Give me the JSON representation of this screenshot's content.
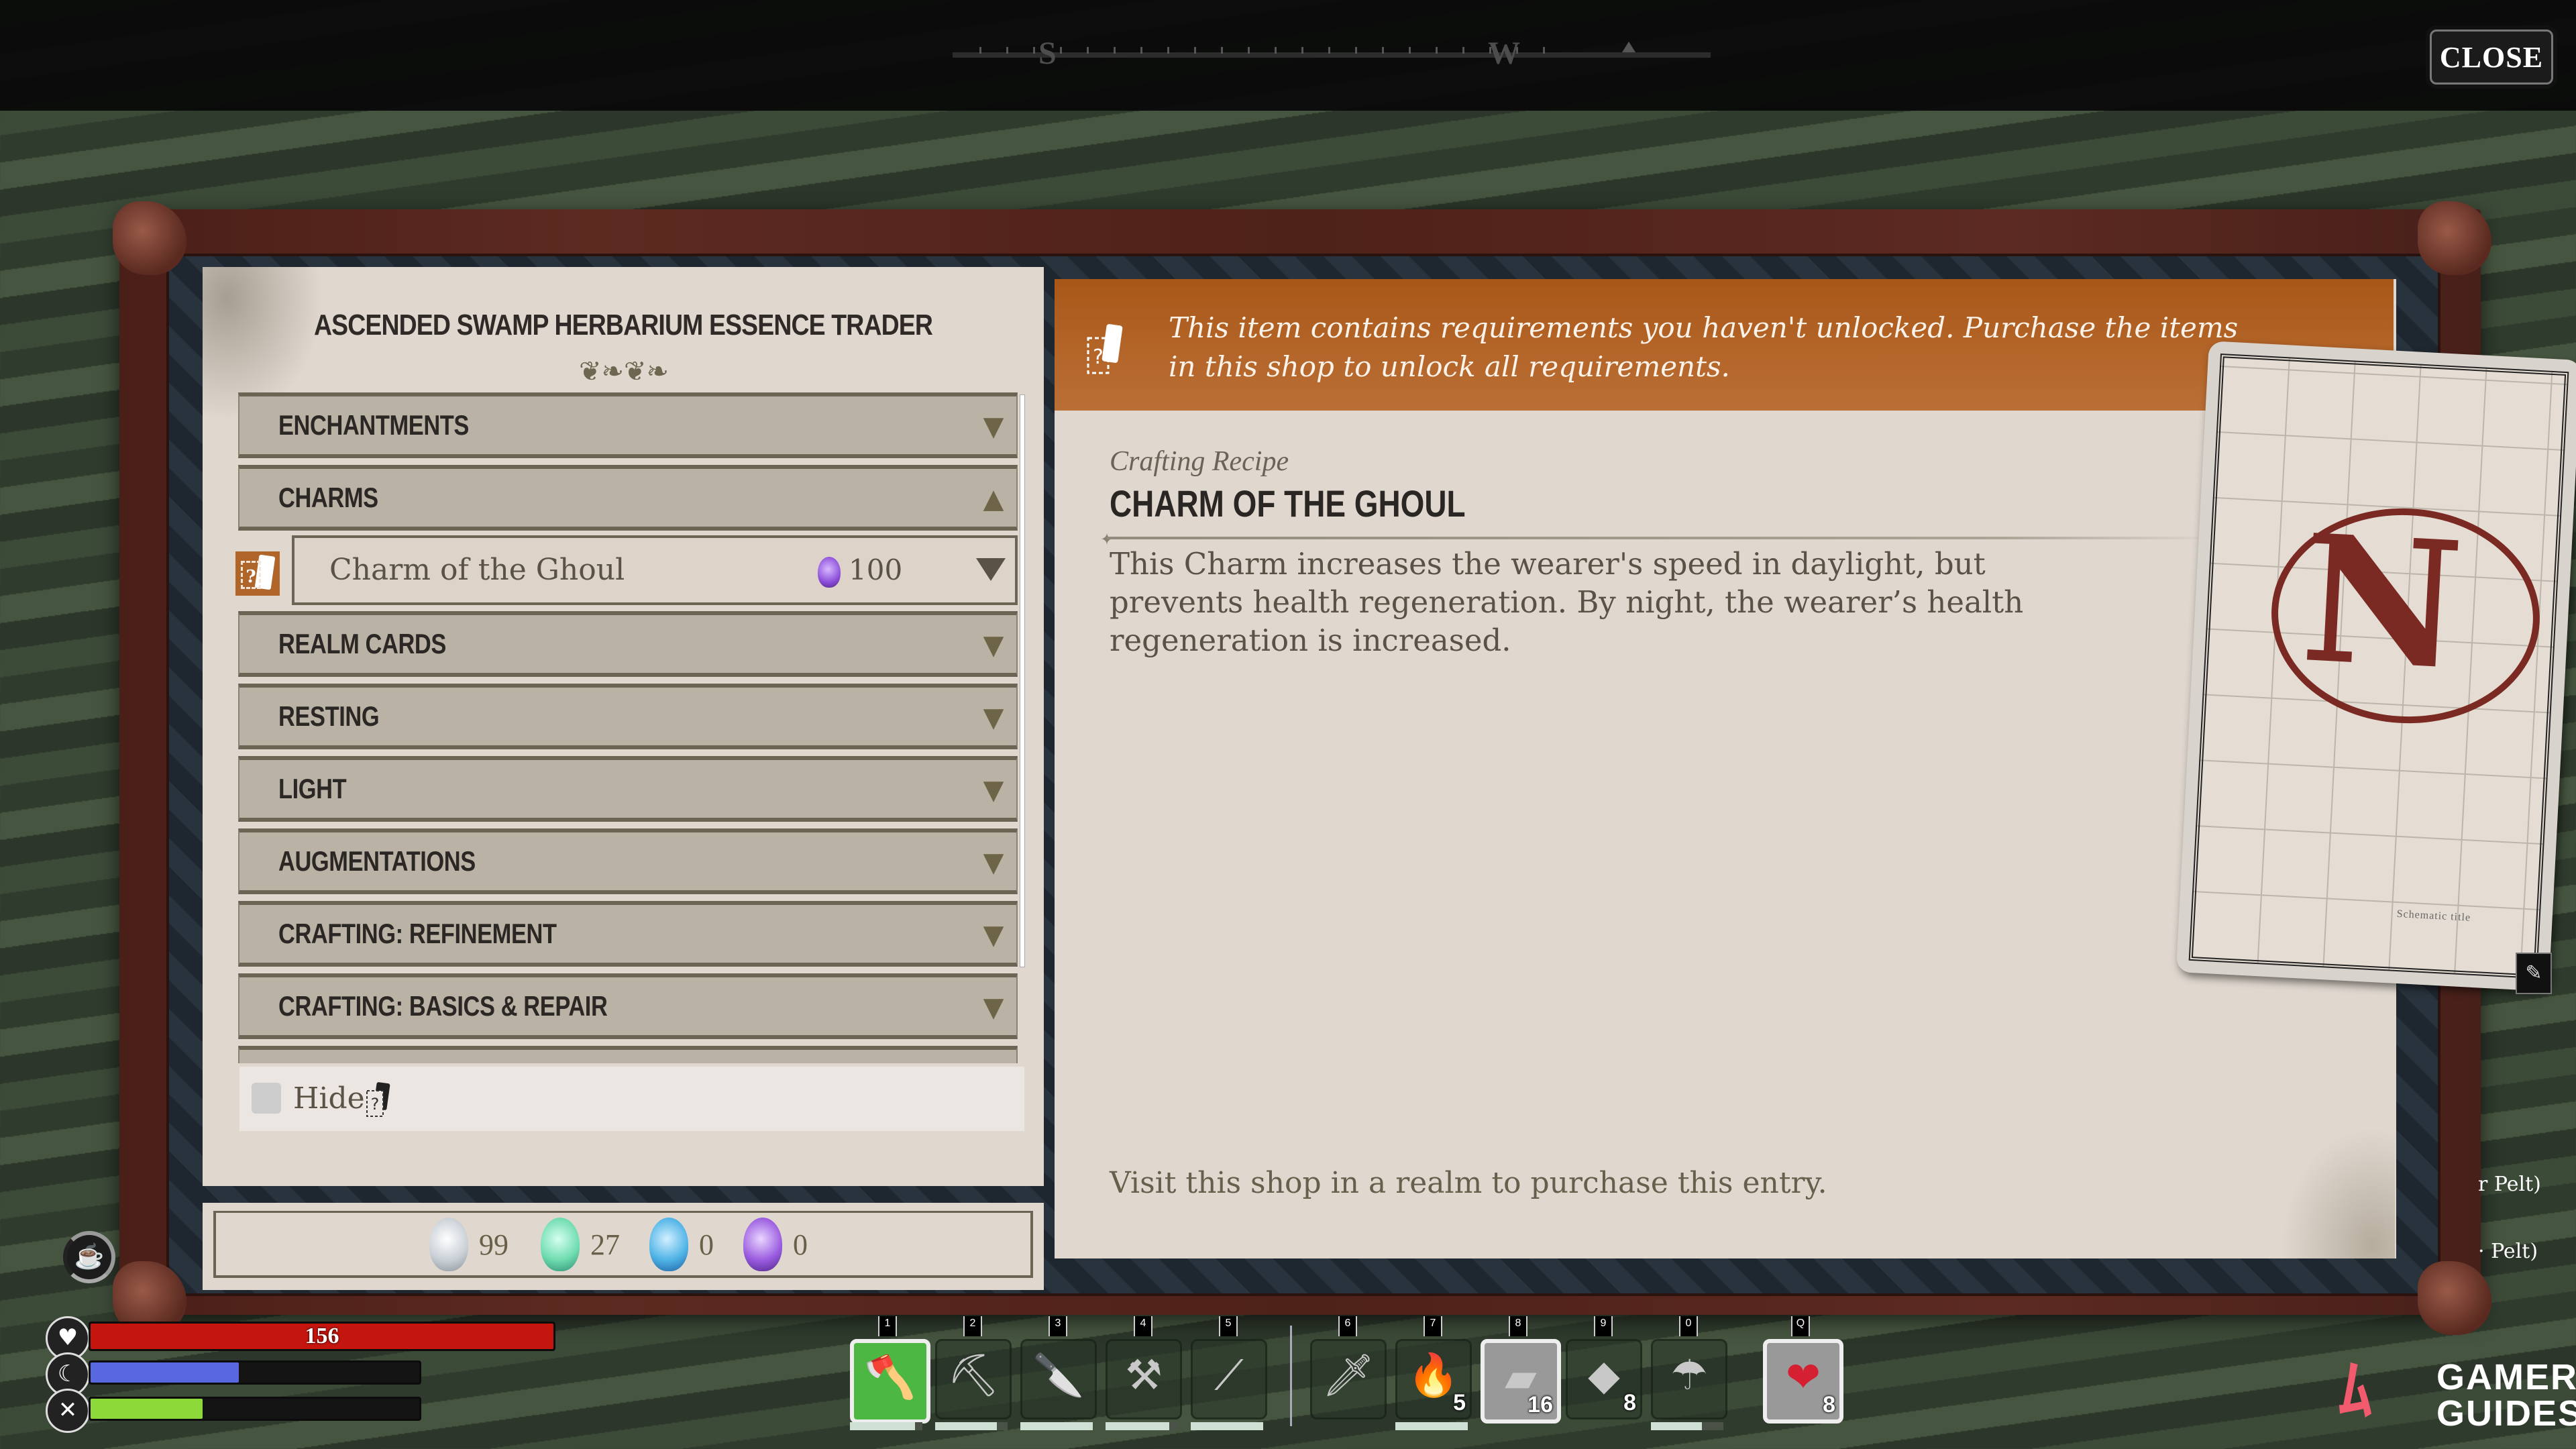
{
  "top_bar": {
    "compass": {
      "letters": [
        "S",
        "W"
      ],
      "marker_icon": "home-marker-icon"
    },
    "close_label": "CLOSE"
  },
  "trader": {
    "title": "ASCENDED SWAMP HERBARIUM ESSENCE TRADER",
    "flourish": "❦❧❦❧",
    "categories": [
      {
        "label": "ENCHANTMENTS",
        "expanded": false
      },
      {
        "label": "CHARMS",
        "expanded": true
      },
      {
        "label": "REALM CARDS",
        "expanded": false
      },
      {
        "label": "RESTING",
        "expanded": false
      },
      {
        "label": "LIGHT",
        "expanded": false
      },
      {
        "label": "AUGMENTATIONS",
        "expanded": false
      },
      {
        "label": "CRAFTING: REFINEMENT",
        "expanded": false
      },
      {
        "label": "CRAFTING: BASICS & REPAIR",
        "expanded": false
      }
    ],
    "selected_item": {
      "name": "Charm of the Ghoul",
      "cost": "100",
      "cost_currency": "purple-essence",
      "locked": true
    },
    "hide_label": "Hide",
    "hide_checked": false,
    "currencies": [
      {
        "name": "white-essence",
        "color": "#e8ecef",
        "value": "99"
      },
      {
        "name": "green-essence",
        "color": "#6fdcb0",
        "value": "27"
      },
      {
        "name": "blue-essence",
        "color": "#4fb3e6",
        "value": "0"
      },
      {
        "name": "purple-essence",
        "color": "#9a5ce0",
        "value": "0"
      }
    ]
  },
  "detail": {
    "warning": "This item contains requirements you haven't unlocked. Purchase the items in this shop to unlock all requirements.",
    "type": "Crafting Recipe",
    "title": "CHARM OF THE GHOUL",
    "description": "This Charm increases the wearer's speed in daylight, but prevents health regeneration. By night, the wearer’s health regeneration is increased.",
    "visit_note": "Visit this shop in a realm to purchase this entry.",
    "card": {
      "letter": "N",
      "caption": "Schematic title"
    }
  },
  "side_text": [
    "r Pelt)",
    "· Pelt)"
  ],
  "hud": {
    "health": {
      "value": "156",
      "fill": 1.0,
      "color": "#c4160f"
    },
    "sleep": {
      "fill": 0.45,
      "color": "#5a68e0"
    },
    "hunger": {
      "fill": 0.34,
      "color": "#8ed93a"
    },
    "buff_icon": "tea-cup-icon"
  },
  "hotbar": {
    "slots": [
      {
        "key": "1",
        "icon": "hatchet-icon",
        "glyph": "🪓",
        "count": "",
        "durability": 0.9,
        "state": "active"
      },
      {
        "key": "2",
        "icon": "pickaxe-icon",
        "glyph": "⛏",
        "count": "",
        "durability": 0.85,
        "state": ""
      },
      {
        "key": "3",
        "icon": "knife-icon",
        "glyph": "🔪",
        "count": "",
        "durability": 1.0,
        "state": ""
      },
      {
        "key": "4",
        "icon": "sickle-icon",
        "glyph": "⚒",
        "count": "",
        "durability": 0.88,
        "state": ""
      },
      {
        "key": "5",
        "icon": "spear-icon",
        "glyph": "⟋",
        "count": "",
        "durability": 1.0,
        "state": ""
      },
      {
        "key": "6",
        "icon": "dagger-icon",
        "glyph": "🗡",
        "count": "",
        "durability": null,
        "state": ""
      },
      {
        "key": "7",
        "icon": "torch-icon",
        "glyph": "🔥",
        "count": "5",
        "durability": 1.0,
        "state": ""
      },
      {
        "key": "8",
        "icon": "leather-icon",
        "glyph": "▰",
        "count": "16",
        "durability": null,
        "state": "selected"
      },
      {
        "key": "9",
        "icon": "cloth-icon",
        "glyph": "◆",
        "count": "8",
        "durability": null,
        "state": ""
      },
      {
        "key": "0",
        "icon": "umbrella-icon",
        "glyph": "☂",
        "count": "",
        "durability": 0.7,
        "state": ""
      },
      {
        "key": "Q",
        "icon": "health-potion-icon",
        "glyph": "❤",
        "count": "8",
        "durability": null,
        "state": "consumable"
      }
    ]
  },
  "watermark": {
    "line1": "GAMER",
    "line2": "GUIDES"
  }
}
